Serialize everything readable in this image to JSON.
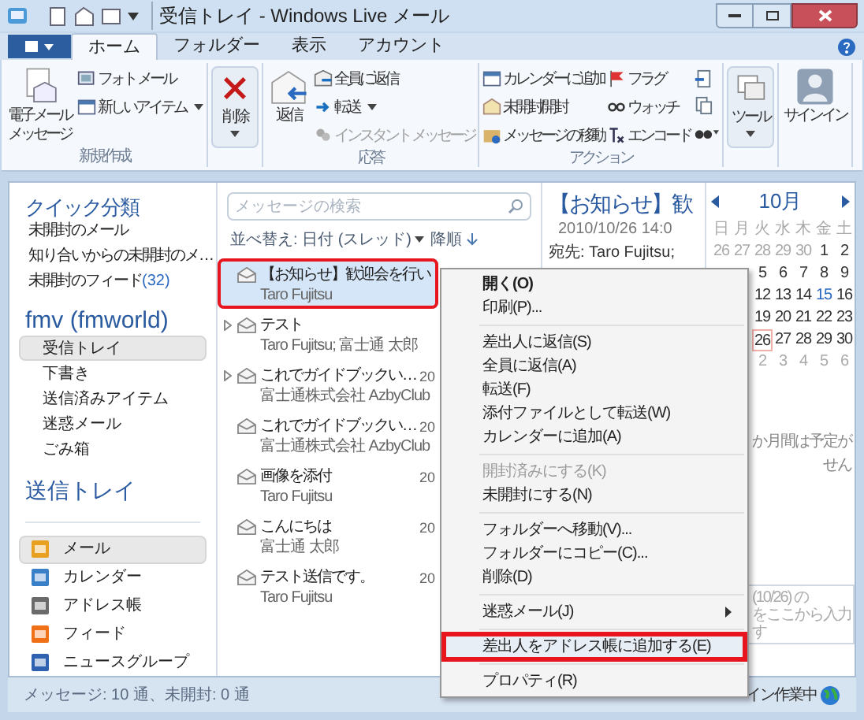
{
  "window": {
    "title": "受信トレイ - Windows Live メール"
  },
  "ribbon_tabs": [
    {
      "label": "ホーム",
      "selected": true
    },
    {
      "label": "フォルダー",
      "selected": false
    },
    {
      "label": "表示",
      "selected": false
    },
    {
      "label": "アカウント",
      "selected": false
    }
  ],
  "ribbon_groups": [
    {
      "label": "新規作成",
      "items": [
        {
          "label": "電子メールメッセージ",
          "kind": "big",
          "disabled": false,
          "dropdown": false
        },
        {
          "label": "フォト メール",
          "kind": "small",
          "disabled": false,
          "dropdown": false
        },
        {
          "label": "新しいアイテム",
          "kind": "small",
          "disabled": false,
          "dropdown": true
        }
      ]
    },
    {
      "items": [
        {
          "label": "削除",
          "kind": "big",
          "disabled": false,
          "dropdown": true
        }
      ]
    },
    {
      "label": "応答",
      "items": [
        {
          "label": "返信",
          "kind": "big",
          "disabled": false,
          "dropdown": false
        },
        {
          "label": "全員に返信",
          "kind": "small",
          "disabled": false,
          "dropdown": false
        },
        {
          "label": "転送",
          "kind": "small",
          "disabled": false,
          "dropdown": true
        },
        {
          "label": "インスタント メッセージ",
          "kind": "small",
          "disabled": true,
          "dropdown": false
        }
      ]
    },
    {
      "label": "アクション",
      "items": [
        {
          "label": "カレンダーに追加",
          "kind": "small",
          "disabled": false,
          "dropdown": false
        },
        {
          "label": "未開封/開封",
          "kind": "small",
          "disabled": false,
          "dropdown": false
        },
        {
          "label": "メッセージの移動",
          "kind": "small",
          "disabled": false,
          "dropdown": false
        },
        {
          "label": "フラグ",
          "kind": "small",
          "disabled": false,
          "dropdown": false
        },
        {
          "label": "ウォッチ",
          "kind": "small",
          "disabled": false,
          "dropdown": false
        },
        {
          "label": "エンコード",
          "kind": "small",
          "disabled": false,
          "dropdown": false
        }
      ]
    },
    {
      "items": [
        {
          "label": "ツール",
          "kind": "big",
          "disabled": false,
          "dropdown": true
        }
      ]
    },
    {
      "items": [
        {
          "label": "サインイン",
          "kind": "big",
          "disabled": false,
          "dropdown": false
        }
      ]
    }
  ],
  "sidebar": {
    "quick_views_title": "クイック分類",
    "quick_views": [
      {
        "label": "未開封のメール"
      },
      {
        "label": "知り合いからの未開封のメ…"
      },
      {
        "label": "未開封のフィード",
        "count": "(32)"
      }
    ],
    "account": "fmv (fmworld)",
    "folders": [
      {
        "label": "受信トレイ",
        "selected": true
      },
      {
        "label": "下書き",
        "selected": false
      },
      {
        "label": "送信済みアイテム",
        "selected": false
      },
      {
        "label": "迷惑メール",
        "selected": false
      },
      {
        "label": "ごみ箱",
        "selected": false
      }
    ],
    "outbox": "送信トレイ",
    "nav": [
      {
        "label": "メール",
        "selected": true
      },
      {
        "label": "カレンダー",
        "selected": false
      },
      {
        "label": "アドレス帳",
        "selected": false
      },
      {
        "label": "フィード",
        "selected": false
      },
      {
        "label": "ニュースグループ",
        "selected": false
      }
    ]
  },
  "message_list": {
    "search": {
      "placeholder": "メッセージの検索"
    },
    "sort": "並べ替え: 日付 (スレッド)",
    "order": "降順",
    "messages": [
      {
        "subject": "【お知らせ】歓迎会を行い",
        "from": "Taro Fujitsu",
        "thread": false,
        "selected": true,
        "highlighted": true
      },
      {
        "subject": "テスト",
        "from": "Taro Fujitsu; 富士通 太郎",
        "thread": true,
        "selected": false,
        "highlighted": false
      },
      {
        "subject": "これでガイドブックい…",
        "from": "富士通株式会社 AzbyClub",
        "date": "20",
        "thread": true,
        "selected": false,
        "highlighted": false
      },
      {
        "subject": "これでガイドブックい…",
        "from": "富士通株式会社 AzbyClub",
        "date": "20",
        "thread": false,
        "selected": false,
        "highlighted": false
      },
      {
        "subject": "画像を添付",
        "from": "Taro Fujitsu",
        "date": "20",
        "thread": false,
        "selected": false,
        "highlighted": false
      },
      {
        "subject": "こんにちは",
        "from": "富士通 太郎",
        "date": "20",
        "thread": false,
        "selected": false,
        "highlighted": false
      },
      {
        "subject": "テスト送信です。",
        "from": "Taro Fujitsu",
        "date": "20",
        "thread": false,
        "selected": false,
        "highlighted": false
      }
    ]
  },
  "reading_pane": {
    "subject": "【お知らせ】歓",
    "date": "2010/10/26 14:0",
    "to": "宛先: Taro Fujitsu;"
  },
  "calendar": {
    "month": "10月",
    "weekdays": [
      "日",
      "月",
      "火",
      "水",
      "木",
      "金",
      "土"
    ],
    "weeks": [
      [
        {
          "d": "26",
          "kind": "other"
        },
        {
          "d": "27",
          "kind": "other"
        },
        {
          "d": "28",
          "kind": "other"
        },
        {
          "d": "29",
          "kind": "other"
        },
        {
          "d": "30",
          "kind": "other"
        },
        {
          "d": "1",
          "kind": "day"
        },
        {
          "d": "2",
          "kind": "day"
        }
      ],
      [
        {
          "d": "5",
          "kind": "day"
        },
        {
          "d": "6",
          "kind": "day"
        },
        {
          "d": "7",
          "kind": "day"
        },
        {
          "d": "8",
          "kind": "day"
        },
        {
          "d": "9",
          "kind": "day"
        }
      ],
      [
        {
          "d": "12",
          "kind": "day"
        },
        {
          "d": "13",
          "kind": "day"
        },
        {
          "d": "14",
          "kind": "day"
        },
        {
          "d": "15",
          "kind": "marked"
        },
        {
          "d": "16",
          "kind": "day"
        }
      ],
      [
        {
          "d": "19",
          "kind": "day"
        },
        {
          "d": "20",
          "kind": "day"
        },
        {
          "d": "21",
          "kind": "day"
        },
        {
          "d": "22",
          "kind": "day"
        },
        {
          "d": "23",
          "kind": "day"
        }
      ],
      [
        {
          "d": "26",
          "kind": "today"
        },
        {
          "d": "27",
          "kind": "day"
        },
        {
          "d": "28",
          "kind": "day"
        },
        {
          "d": "29",
          "kind": "day"
        },
        {
          "d": "30",
          "kind": "day"
        }
      ],
      [
        {
          "d": "2",
          "kind": "other"
        },
        {
          "d": "3",
          "kind": "other"
        },
        {
          "d": "4",
          "kind": "other"
        },
        {
          "d": "5",
          "kind": "other"
        },
        {
          "d": "6",
          "kind": "other"
        }
      ]
    ],
    "note_lines": [
      "か月間は予定が",
      "せん"
    ],
    "entry_lines": [
      "(10/26) の",
      "をここから入力",
      "す"
    ]
  },
  "context_menu": [
    {
      "kind": "item",
      "label": "開く(O)",
      "bold": true,
      "disabled": false,
      "submenu": false,
      "highlighted": false
    },
    {
      "kind": "item",
      "label": "印刷(P)...",
      "bold": false,
      "disabled": false,
      "submenu": false,
      "highlighted": false
    },
    {
      "kind": "separator"
    },
    {
      "kind": "item",
      "label": "差出人に返信(S)",
      "bold": false,
      "disabled": false,
      "submenu": false,
      "highlighted": false
    },
    {
      "kind": "item",
      "label": "全員に返信(A)",
      "bold": false,
      "disabled": false,
      "submenu": false,
      "highlighted": false
    },
    {
      "kind": "item",
      "label": "転送(F)",
      "bold": false,
      "disabled": false,
      "submenu": false,
      "highlighted": false
    },
    {
      "kind": "item",
      "label": "添付ファイルとして転送(W)",
      "bold": false,
      "disabled": false,
      "submenu": false,
      "highlighted": false
    },
    {
      "kind": "item",
      "label": "カレンダーに追加(A)",
      "bold": false,
      "disabled": false,
      "submenu": false,
      "highlighted": false
    },
    {
      "kind": "separator"
    },
    {
      "kind": "item",
      "label": "開封済みにする(K)",
      "bold": false,
      "disabled": true,
      "submenu": false,
      "highlighted": false
    },
    {
      "kind": "item",
      "label": "未開封にする(N)",
      "bold": false,
      "disabled": false,
      "submenu": false,
      "highlighted": false
    },
    {
      "kind": "separator"
    },
    {
      "kind": "item",
      "label": "フォルダーへ移動(V)...",
      "bold": false,
      "disabled": false,
      "submenu": false,
      "highlighted": false
    },
    {
      "kind": "item",
      "label": "フォルダーにコピー(C)...",
      "bold": false,
      "disabled": false,
      "submenu": false,
      "highlighted": false
    },
    {
      "kind": "item",
      "label": "削除(D)",
      "bold": false,
      "disabled": false,
      "submenu": false,
      "highlighted": false
    },
    {
      "kind": "separator"
    },
    {
      "kind": "item",
      "label": "迷惑メール(J)",
      "bold": false,
      "disabled": false,
      "submenu": true,
      "highlighted": false
    },
    {
      "kind": "separator"
    },
    {
      "kind": "item",
      "label": "差出人をアドレス帳に追加する(E)",
      "bold": false,
      "disabled": false,
      "submenu": false,
      "highlighted": true
    },
    {
      "kind": "separator"
    },
    {
      "kind": "item",
      "label": "プロパティ(R)",
      "bold": false,
      "disabled": false,
      "submenu": false,
      "highlighted": false
    }
  ],
  "status_bar": {
    "left": "メッセージ: 10 通、未開封: 0 通",
    "right": "イン作業中"
  }
}
